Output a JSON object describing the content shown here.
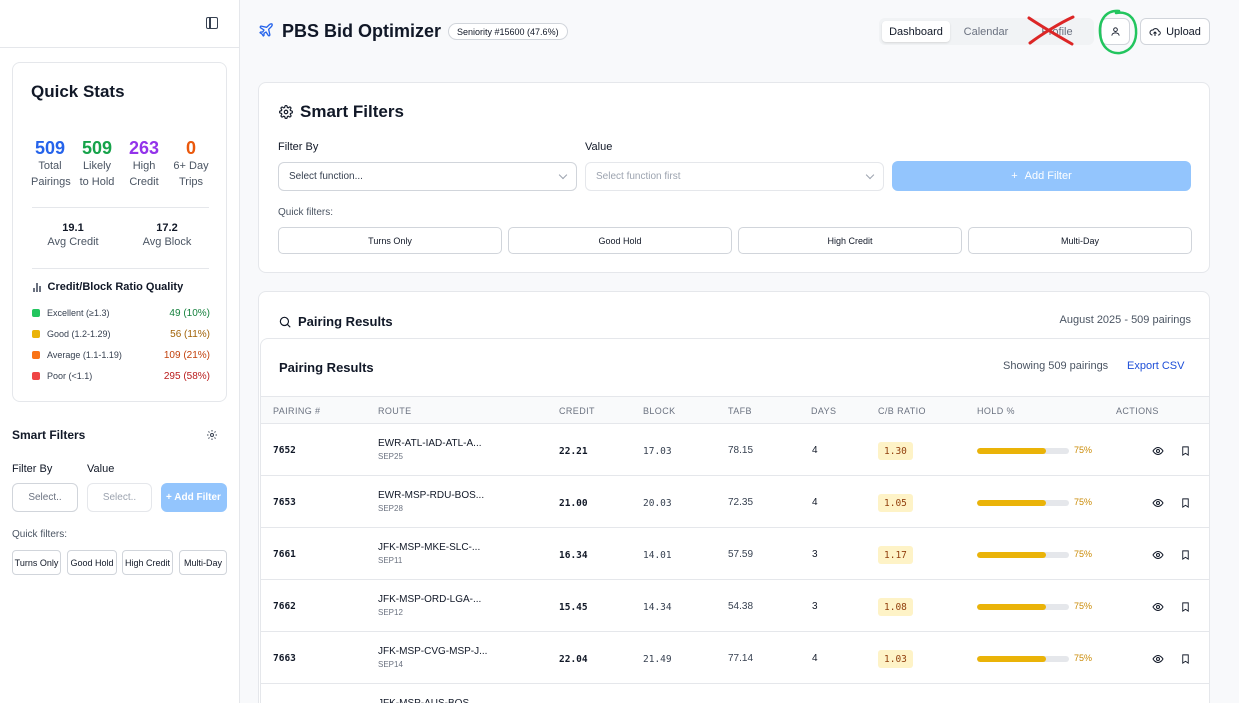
{
  "sidebar": {
    "quick_stats": {
      "title": "Quick Stats",
      "stats": [
        {
          "value": "509",
          "label1": "Total",
          "label2": "Pairings",
          "color": "#2563eb"
        },
        {
          "value": "509",
          "label1": "Likely",
          "label2": "to Hold",
          "color": "#16a34a"
        },
        {
          "value": "263",
          "label1": "High",
          "label2": "Credit",
          "color": "#9333ea"
        },
        {
          "value": "0",
          "label1": "6+ Day",
          "label2": "Trips",
          "color": "#ea580c"
        }
      ],
      "avg_credit": {
        "value": "19.1",
        "label": "Avg Credit"
      },
      "avg_block": {
        "value": "17.2",
        "label": "Avg Block"
      },
      "ratio_title": "Credit/Block Ratio Quality",
      "ratios": [
        {
          "label": "Excellent (≥1.3)",
          "value": "49 (10%)",
          "color": "#22c55e",
          "text_color": "#15803d"
        },
        {
          "label": "Good (1.2-1.29)",
          "value": "56 (11%)",
          "color": "#eab308",
          "text_color": "#a16207"
        },
        {
          "label": "Average (1.1-1.19)",
          "value": "109 (21%)",
          "color": "#f97316",
          "text_color": "#c2410c"
        },
        {
          "label": "Poor (<1.1)",
          "value": "295 (58%)",
          "color": "#ef4444",
          "text_color": "#b91c1c"
        }
      ]
    },
    "smart_filters": {
      "title": "Smart Filters",
      "filter_by_label": "Filter By",
      "value_label": "Value",
      "filter_placeholder": "Select..",
      "value_placeholder": "Select..",
      "add_label": "+ Add Filter",
      "quick_label": "Quick filters:",
      "chips": [
        "Turns Only",
        "Good Hold",
        "High Credit",
        "Multi-Day"
      ]
    }
  },
  "header": {
    "title": "PBS Bid Optimizer",
    "seniority": "Seniority #15600 (47.6%)",
    "tabs": [
      "Dashboard",
      "Calendar",
      "Profile"
    ],
    "active_tab": "Dashboard",
    "upload_label": "Upload"
  },
  "filters": {
    "title": "Smart Filters",
    "filter_by_label": "Filter By",
    "value_label": "Value",
    "filter_placeholder": "Select function...",
    "value_placeholder": "Select function first",
    "add_label": "Add Filter",
    "quick_label": "Quick filters:",
    "chips": [
      "Turns Only",
      "Good Hold",
      "High Credit",
      "Multi-Day"
    ]
  },
  "results": {
    "title": "Pairing Results",
    "meta": "August 2025 - 509 pairings",
    "inner_title": "Pairing Results",
    "showing": "Showing 509 pairings",
    "export_label": "Export CSV",
    "columns": [
      "PAIRING #",
      "ROUTE",
      "CREDIT",
      "BLOCK",
      "TAFB",
      "DAYS",
      "C/B RATIO",
      "HOLD %",
      "ACTIONS"
    ],
    "rows": [
      {
        "pairing": "7652",
        "route": "EWR-ATL-IAD-ATL-A...",
        "date": "SEP25",
        "credit": "22.21",
        "block": "17.03",
        "tafb": "78.15",
        "days": "4",
        "ratio": "1.30",
        "hold_pct": 75,
        "hold_label": "75%"
      },
      {
        "pairing": "7653",
        "route": "EWR-MSP-RDU-BOS...",
        "date": "SEP28",
        "credit": "21.00",
        "block": "20.03",
        "tafb": "72.35",
        "days": "4",
        "ratio": "1.05",
        "hold_pct": 75,
        "hold_label": "75%"
      },
      {
        "pairing": "7661",
        "route": "JFK-MSP-MKE-SLC-...",
        "date": "SEP11",
        "credit": "16.34",
        "block": "14.01",
        "tafb": "57.59",
        "days": "3",
        "ratio": "1.17",
        "hold_pct": 75,
        "hold_label": "75%"
      },
      {
        "pairing": "7662",
        "route": "JFK-MSP-ORD-LGA-...",
        "date": "SEP12",
        "credit": "15.45",
        "block": "14.34",
        "tafb": "54.38",
        "days": "3",
        "ratio": "1.08",
        "hold_pct": 75,
        "hold_label": "75%"
      },
      {
        "pairing": "7663",
        "route": "JFK-MSP-CVG-MSP-J...",
        "date": "SEP14",
        "credit": "22.04",
        "block": "21.49",
        "tafb": "77.14",
        "days": "4",
        "ratio": "1.03",
        "hold_pct": 75,
        "hold_label": "75%"
      },
      {
        "pairing": "",
        "route": "JFK-MSP-AUS-BOS...",
        "date": "",
        "credit": "",
        "block": "",
        "tafb": "",
        "days": "",
        "ratio": "",
        "hold_pct": 75,
        "hold_label": ""
      }
    ]
  },
  "colors": {
    "accent": "#2563eb",
    "annotation_x": "#dc2626",
    "annotation_circle": "#22c55e"
  }
}
